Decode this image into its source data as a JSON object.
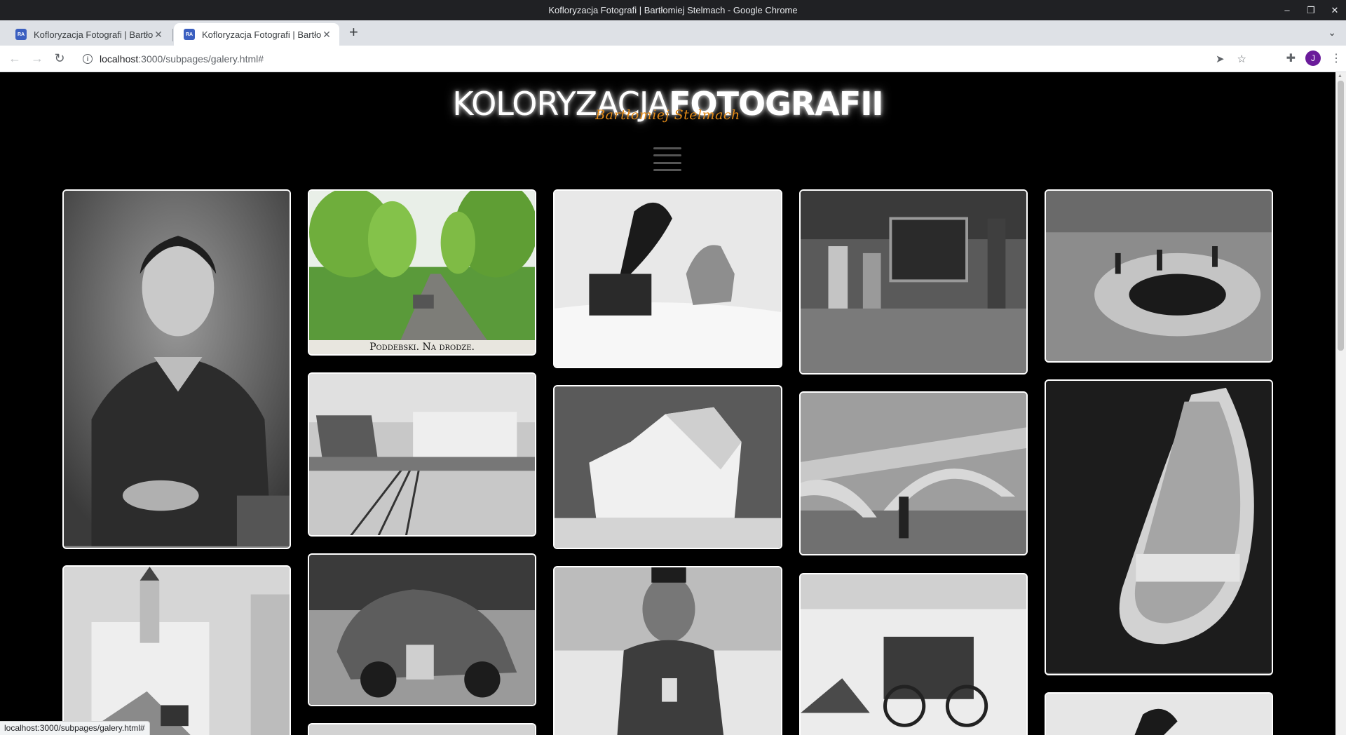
{
  "window": {
    "title": "Kofloryzacja Fotografi | Bartłomiej Stelmach - Google Chrome",
    "controls": [
      "–",
      "❐",
      "✕"
    ]
  },
  "tabs": [
    {
      "title": "Kofloryzacja Fotografi | Bartłomiej Stelmach",
      "favicon": "RA"
    },
    {
      "title": "Kofloryzacja Fotografi | Bartłomiej Stelmach",
      "favicon": "RA"
    }
  ],
  "toolbar": {
    "url_host": "localhost",
    "url_path": ":3000/subpages/galery.html#",
    "avatar_letter": "J"
  },
  "page": {
    "logo_light": "KOLORYZACJA",
    "logo_bold": "FOTOGRAFII",
    "logo_signature": "Bartłomiej Stelmach",
    "caption_photo_2": "Poddebski. Na drodze."
  },
  "status_bar": "localhost:3000/subpages/galery.html#",
  "colors": {
    "page_background": "#000000",
    "signature": "#e28a18",
    "photo_border": "#ffffff"
  },
  "photos": [
    {
      "name": "photo-portrait-woman",
      "icon": "portrait-image"
    },
    {
      "name": "photo-church-street",
      "icon": "street-image"
    },
    {
      "name": "photo-road-car-colorized",
      "icon": "road-image"
    },
    {
      "name": "photo-harbor-railway",
      "icon": "harbor-image"
    },
    {
      "name": "photo-vintage-car",
      "icon": "car-image"
    },
    {
      "name": "photo-gramophone-dog",
      "icon": "gramophone-image"
    },
    {
      "name": "photo-iceberg",
      "icon": "iceberg-image"
    },
    {
      "name": "photo-polar-explorer",
      "icon": "explorer-image"
    },
    {
      "name": "photo-mine-painting",
      "icon": "mine-image"
    },
    {
      "name": "photo-bridge",
      "icon": "bridge-image"
    },
    {
      "name": "photo-winter-wagon",
      "icon": "wagon-image"
    },
    {
      "name": "photo-rooftop-crater",
      "icon": "rooftop-image"
    },
    {
      "name": "photo-ice-cave",
      "icon": "ice-cave-image"
    },
    {
      "name": "photo-gramophone-partial",
      "icon": "gramophone-image"
    }
  ]
}
